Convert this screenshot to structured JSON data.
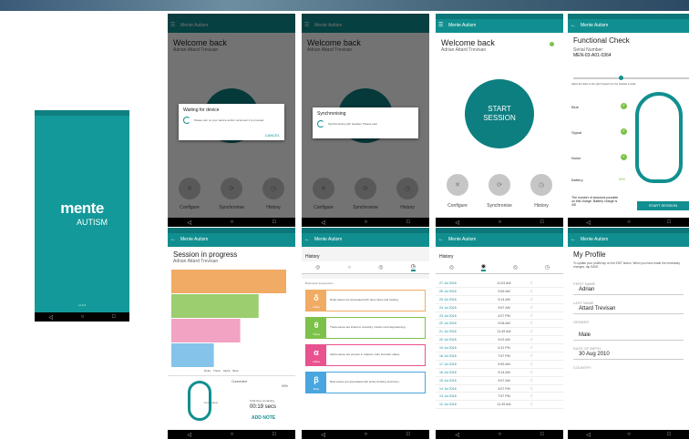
{
  "colors": {
    "teal": "#118f90",
    "teal_dark": "#0d7f80",
    "splash": "#14999a",
    "grey_button": "#c6c6c6",
    "bar_orange": "#f0ab64",
    "bar_green": "#9ccd6e",
    "bar_pink": "#f2a2c3",
    "bar_blue": "#86c3ea"
  },
  "app_title": "Mente Autism",
  "splash": {
    "logo": "mente",
    "tagline": "AUTISM",
    "version": "v1.0.4"
  },
  "home": {
    "title": "Welcome back",
    "user": "Adrian Attard Trevisan",
    "start_label_1": "START",
    "start_label_2": "SESSION",
    "buttons": {
      "configure": "Configure",
      "synchronise": "Synchronise",
      "history": "History"
    },
    "icons": {
      "configure": "wrench-icon",
      "synchronise": "sync-icon",
      "history": "clock-icon"
    }
  },
  "waiting_dialog": {
    "title": "Waiting for device",
    "body": "Please turn on your device and/or reconnect it to proceed.",
    "action": "CANCEL"
  },
  "sync_dialog": {
    "title": "Synchronising",
    "body": "Synchronising with headset. Please wait."
  },
  "functional_check": {
    "title": "Functional Check",
    "serial_label": "Serial Number:",
    "serial": "MEN-03-A01-0364",
    "slider_hint": "Adjust the slider to the right if signal from the headset is weak",
    "rows": {
      "blue": "Blue",
      "signal": "Signal",
      "noise": "Noise",
      "battery": "Battery"
    },
    "battery_value": "50%",
    "sessions_note": "The number of sessions possible on this charge. Battery charge is 4/5",
    "action": "START SESSION"
  },
  "session": {
    "title": "Session in progress",
    "user": "Adrian Attard Trevisan",
    "legend": [
      "Delta",
      "Theta",
      "Alpha",
      "Beta"
    ],
    "status_label": "Connected",
    "signal_value": "93%",
    "connected_label": "Connected",
    "time_label": "Total time remaining",
    "time_value": "00:19 secs",
    "action": "ADD NOTE"
  },
  "chart_data": {
    "type": "bar",
    "categories": [
      "Delta",
      "Theta",
      "Alpha",
      "Beta"
    ],
    "values": [
      100,
      76,
      60,
      37
    ],
    "colors": [
      "#f0ab64",
      "#9ccd6e",
      "#f2a2c3",
      "#86c3ea"
    ]
  },
  "history_cards": {
    "title": "History",
    "note": "Brainwave frequencies",
    "cards": [
      {
        "symbol": "δ",
        "name": "Delta",
        "color": "#f0ab64",
        "text": "Delta waves are associated with deep sleep and healing."
      },
      {
        "symbol": "θ",
        "name": "Theta",
        "color": "#7cc24a",
        "text": "Theta waves are linked to creativity, intuition and daydreaming."
      },
      {
        "symbol": "α",
        "name": "Alpha",
        "color": "#e8528e",
        "text": "Alpha waves are present in relaxed, calm and alert states."
      },
      {
        "symbol": "β",
        "name": "Beta",
        "color": "#4aa6de",
        "text": "Beta waves are associated with active thinking and focus."
      }
    ]
  },
  "history_list": {
    "title": "History",
    "rows": [
      {
        "date": "27 Jul 2018",
        "time": "11:03 AM"
      },
      {
        "date": "26 Jul 2018",
        "time": "9:59 AM"
      },
      {
        "date": "25 Jul 2018",
        "time": "9:14 AM"
      },
      {
        "date": "24 Jul 2018",
        "time": "9:57 AM"
      },
      {
        "date": "23 Jul 2018",
        "time": "4:07 PM"
      },
      {
        "date": "22 Jul 2018",
        "time": "9:08 AM"
      },
      {
        "date": "21 Jul 2018",
        "time": "11:49 AM"
      },
      {
        "date": "20 Jul 2018",
        "time": "9:02 AM"
      },
      {
        "date": "19 Jul 2018",
        "time": "4:31 PM"
      },
      {
        "date": "18 Jul 2018",
        "time": "7:57 PM"
      },
      {
        "date": "17 Jul 2018",
        "time": "9:59 AM"
      },
      {
        "date": "16 Jul 2018",
        "time": "9:14 AM"
      },
      {
        "date": "15 Jul 2018",
        "time": "9:57 AM"
      },
      {
        "date": "14 Jul 2018",
        "time": "4:07 PM"
      },
      {
        "date": "13 Jul 2018",
        "time": "7:57 PM"
      },
      {
        "date": "12 Jul 2018",
        "time": "11:49 AM"
      }
    ]
  },
  "profile": {
    "title": "My Profile",
    "note": "To update your profile tap on the EDIT button. When you have made the necessary changes, tap SAVE.",
    "fields": [
      {
        "label": "FIRST NAME",
        "value": "Adrian"
      },
      {
        "label": "LAST NAME",
        "value": "Attard Trevisan"
      },
      {
        "label": "GENDER",
        "value": "Male"
      },
      {
        "label": "DATE OF BIRTH",
        "value": "30 Aug 2010"
      },
      {
        "label": "COUNTRY",
        "value": ""
      }
    ]
  }
}
